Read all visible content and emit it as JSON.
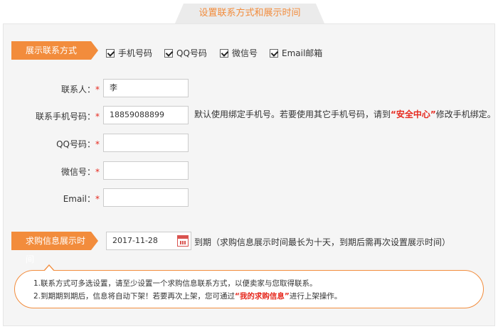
{
  "page_title": "设置联系方式和展示时间",
  "display_section": {
    "label": "展示联系方式",
    "options": [
      {
        "label": "手机号码",
        "checked": true
      },
      {
        "label": "QQ号码",
        "checked": true
      },
      {
        "label": "微信号",
        "checked": true
      },
      {
        "label": "Email邮箱",
        "checked": true
      }
    ]
  },
  "fields": {
    "contact": {
      "label": "联系人：",
      "required_mark": "*",
      "value": "李"
    },
    "phone": {
      "label": "联系手机号码：",
      "required_mark": "*",
      "value": "18859088899"
    },
    "qq": {
      "label": "QQ号码：",
      "required_mark": "*",
      "value": ""
    },
    "wechat": {
      "label": "微信号：",
      "required_mark": "*",
      "value": ""
    },
    "email": {
      "label": "Email：",
      "required_mark": "*",
      "value": ""
    }
  },
  "phone_hint": {
    "before": "默认使用绑定手机号。若要使用其它手机号码，请到",
    "link": "“安全中心”",
    "after": "修改手机绑定。"
  },
  "expiry_section": {
    "label": "求购信息展示时间",
    "date_value": "2017-11-28",
    "note": "到期（求购信息展示时间最长为十天，到期后需再次设置展示时间）"
  },
  "notice": {
    "line1": "1.联系方式可多选设置，请至少设置一个求购信息联系方式，以便卖家与您取得联系。",
    "line2_before": "2.到期期到期后，信息将自动下架！若要再次上架，您可通过",
    "line2_link": "“我的求购信息”",
    "line2_after": "进行上架操作。"
  }
}
